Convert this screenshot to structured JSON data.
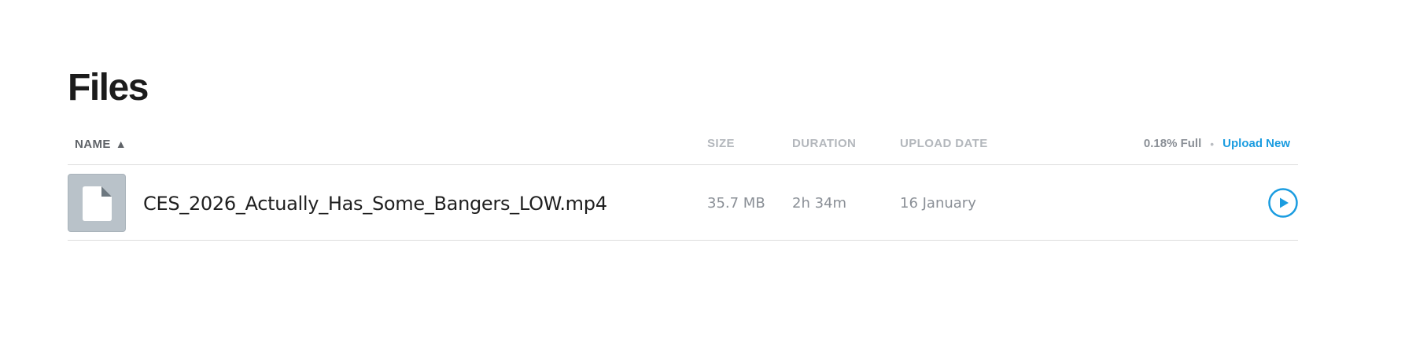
{
  "page": {
    "title": "Files"
  },
  "table": {
    "headers": {
      "name": "NAME",
      "name_sort_glyph": "▲",
      "size": "SIZE",
      "duration": "DURATION",
      "upload_date": "UPLOAD DATE"
    },
    "storage": {
      "usage": "0.18% Full",
      "separator": "•",
      "upload_label": "Upload New"
    },
    "rows": [
      {
        "name": "CES_2026_Actually_Has_Some_Bangers_LOW.mp4",
        "size": "35.7 MB",
        "duration": "2h 34m",
        "upload_date": "16 January",
        "thumb_icon": "file-icon",
        "action_icon": "play-icon"
      }
    ]
  },
  "colors": {
    "accent": "#1a9ce0",
    "thumb_bg": "#b9c2c9",
    "muted_text": "#8a8f96",
    "header_text": "#b3b7bc",
    "divider": "#dcdcdc"
  }
}
